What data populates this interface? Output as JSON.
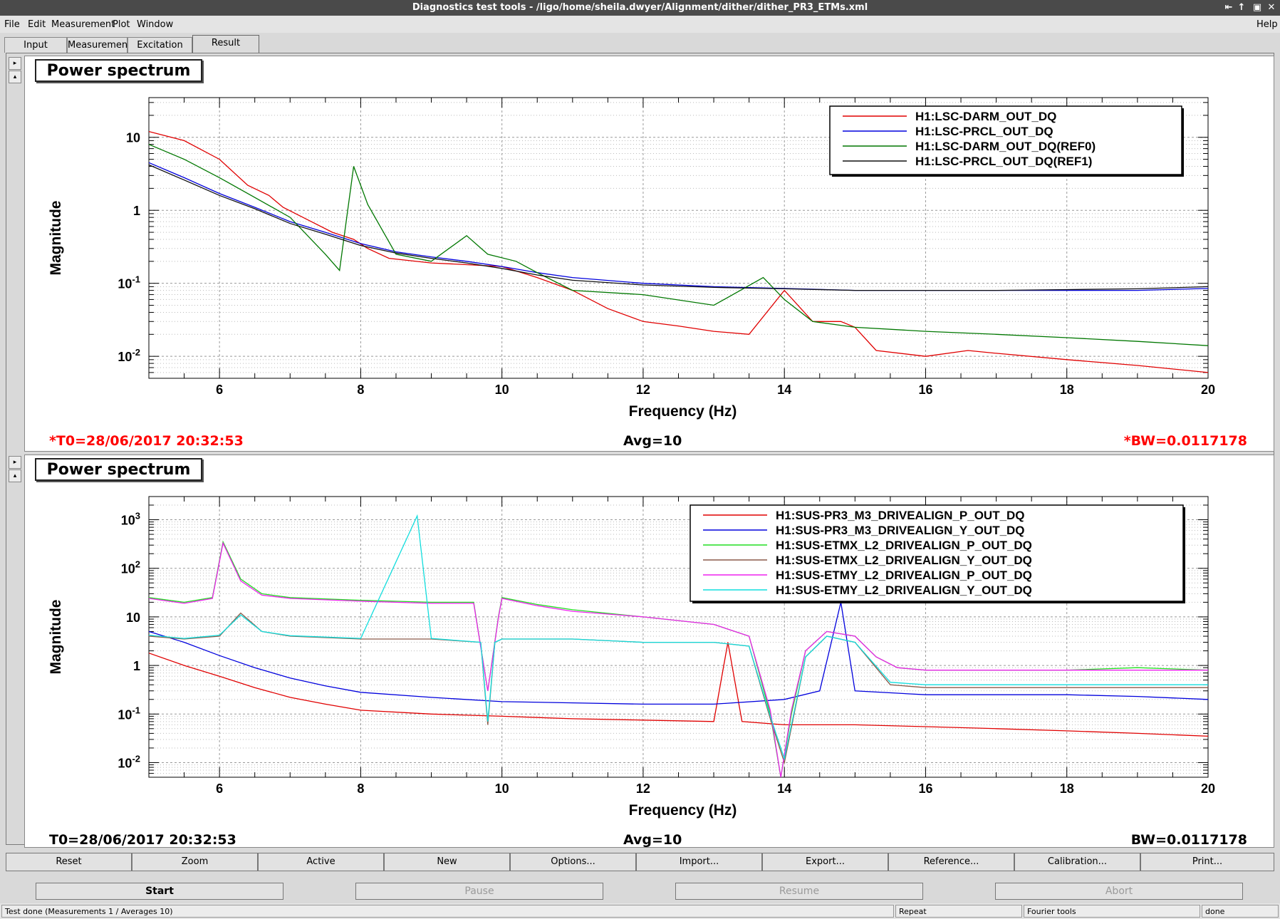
{
  "window": {
    "title": "Diagnostics test tools - /ligo/home/sheila.dwyer/Alignment/dither/dither_PR3_ETMs.xml",
    "controls": [
      "⇤",
      "↑",
      "▣",
      "✕"
    ]
  },
  "menu": {
    "items": [
      "File",
      "Edit",
      "Measurement",
      "Plot",
      "Window"
    ],
    "help": "Help"
  },
  "tabs": [
    "Input",
    "Measurement",
    "Excitation",
    "Result"
  ],
  "active_tab": "Result",
  "panels": [
    {
      "title": "Power spectrum",
      "footer": {
        "t0": "*T0=28/06/2017 20:32:53",
        "avg": "Avg=10",
        "bw": "*BW=0.0117178",
        "color": "#ff0000"
      }
    },
    {
      "title": "Power spectrum",
      "footer": {
        "t0": "T0=28/06/2017 20:32:53",
        "avg": "Avg=10",
        "bw": "BW=0.0117178",
        "color": "#000000"
      }
    }
  ],
  "chart_data": [
    {
      "type": "line",
      "title": "Power spectrum",
      "xlabel": "Frequency (Hz)",
      "ylabel": "Magnitude",
      "xlim": [
        5,
        20
      ],
      "ylim": [
        0.005,
        35
      ],
      "yscale": "log",
      "grid": true,
      "legend_position": "top-right",
      "x_ticks": [
        "6",
        "8",
        "10",
        "12",
        "14",
        "16",
        "18",
        "20"
      ],
      "y_ticks": [
        "10",
        "1",
        "10-1",
        "10-2"
      ],
      "series": [
        {
          "name": "H1:LSC-DARM_OUT_DQ",
          "color": "#e00000",
          "x": [
            5,
            5.5,
            6,
            6.4,
            6.7,
            6.9,
            7.3,
            7.6,
            7.9,
            8.1,
            8.4,
            9,
            9.5,
            10,
            10.5,
            11,
            11.5,
            12,
            12.5,
            13,
            13.5,
            14,
            14.4,
            14.8,
            15,
            15.3,
            16,
            16.6,
            17,
            18,
            19,
            20
          ],
          "y": [
            12,
            9,
            5,
            2.2,
            1.6,
            1.1,
            0.7,
            0.5,
            0.4,
            0.3,
            0.22,
            0.19,
            0.18,
            0.17,
            0.12,
            0.08,
            0.045,
            0.03,
            0.026,
            0.022,
            0.02,
            0.08,
            0.03,
            0.03,
            0.025,
            0.012,
            0.01,
            0.012,
            0.011,
            0.009,
            0.0075,
            0.006
          ]
        },
        {
          "name": "H1:LSC-PRCL_OUT_DQ",
          "color": "#0000dd",
          "x": [
            5,
            5.5,
            6,
            6.5,
            7,
            7.5,
            8,
            8.5,
            9,
            9.5,
            10,
            10.5,
            11,
            12,
            13,
            14,
            15,
            16,
            17,
            18,
            19,
            20
          ],
          "y": [
            4.5,
            2.8,
            1.7,
            1.1,
            0.7,
            0.5,
            0.35,
            0.27,
            0.23,
            0.2,
            0.17,
            0.14,
            0.12,
            0.1,
            0.09,
            0.085,
            0.08,
            0.08,
            0.08,
            0.08,
            0.08,
            0.085
          ]
        },
        {
          "name": "H1:LSC-DARM_OUT_DQ(REF0)",
          "color": "#007700",
          "x": [
            5,
            5.5,
            6,
            6.5,
            7,
            7.5,
            7.7,
            7.9,
            8.1,
            8.5,
            9,
            9.5,
            9.8,
            10.2,
            10.5,
            11,
            12,
            13,
            13.7,
            14,
            14.4,
            15,
            16,
            17,
            18,
            19,
            20
          ],
          "y": [
            8,
            5,
            2.8,
            1.5,
            0.8,
            0.25,
            0.15,
            4,
            1.2,
            0.25,
            0.2,
            0.45,
            0.25,
            0.2,
            0.14,
            0.08,
            0.07,
            0.05,
            0.12,
            0.06,
            0.03,
            0.025,
            0.022,
            0.02,
            0.018,
            0.016,
            0.014
          ]
        },
        {
          "name": "H1:LSC-PRCL_OUT_DQ(REF1)",
          "color": "#111111",
          "x": [
            5,
            5.5,
            6,
            6.5,
            7,
            7.5,
            8,
            8.5,
            9,
            9.5,
            10,
            10.5,
            11,
            12,
            13,
            14,
            15,
            16,
            17,
            18,
            19,
            20
          ],
          "y": [
            4.2,
            2.6,
            1.6,
            1.05,
            0.66,
            0.47,
            0.33,
            0.26,
            0.22,
            0.19,
            0.16,
            0.13,
            0.11,
            0.095,
            0.088,
            0.084,
            0.08,
            0.08,
            0.08,
            0.082,
            0.084,
            0.09
          ]
        }
      ]
    },
    {
      "type": "line",
      "title": "Power spectrum",
      "xlabel": "Frequency (Hz)",
      "ylabel": "Magnitude",
      "xlim": [
        5,
        20
      ],
      "ylim": [
        0.005,
        3000
      ],
      "yscale": "log",
      "grid": true,
      "legend_position": "top-right",
      "x_ticks": [
        "6",
        "8",
        "10",
        "12",
        "14",
        "16",
        "18",
        "20"
      ],
      "y_ticks": [
        "10^3",
        "10^2",
        "10",
        "1",
        "10^-1",
        "10^-2"
      ],
      "series": [
        {
          "name": "H1:SUS-PR3_M3_DRIVEALIGN_P_OUT_DQ",
          "color": "#e00000",
          "x": [
            5,
            5.5,
            6,
            6.5,
            7,
            7.5,
            8,
            9,
            10,
            11,
            12,
            13,
            13.2,
            13.4,
            14,
            15,
            16,
            17,
            18,
            19,
            20
          ],
          "y": [
            1.8,
            1,
            0.6,
            0.35,
            0.22,
            0.16,
            0.12,
            0.1,
            0.09,
            0.08,
            0.075,
            0.07,
            3,
            0.07,
            0.06,
            0.06,
            0.055,
            0.05,
            0.045,
            0.04,
            0.035
          ]
        },
        {
          "name": "H1:SUS-PR3_M3_DRIVEALIGN_Y_OUT_DQ",
          "color": "#0000dd",
          "x": [
            5,
            5.5,
            6,
            6.5,
            7,
            7.5,
            8,
            9,
            10,
            11,
            12,
            13,
            14,
            14.5,
            14.8,
            15,
            16,
            17,
            18,
            19,
            20
          ],
          "y": [
            5,
            3,
            1.6,
            0.9,
            0.55,
            0.38,
            0.28,
            0.22,
            0.18,
            0.17,
            0.16,
            0.16,
            0.2,
            0.3,
            20,
            0.3,
            0.25,
            0.25,
            0.25,
            0.23,
            0.2
          ]
        },
        {
          "name": "H1:SUS-ETMX_L2_DRIVEALIGN_P_OUT_DQ",
          "color": "#22dd22",
          "x": [
            5,
            5.5,
            5.9,
            6.05,
            6.3,
            6.6,
            7,
            8,
            9,
            9.6,
            9.8,
            9.95,
            10,
            10.5,
            11,
            12,
            13,
            13.5,
            13.8,
            13.95,
            14.1,
            14.3,
            14.6,
            15,
            15.3,
            15.6,
            16,
            17,
            18,
            19,
            20
          ],
          "y": [
            25,
            20,
            25,
            350,
            60,
            30,
            25,
            22,
            20,
            20,
            0.3,
            10,
            25,
            18,
            14,
            10,
            7,
            4,
            0.1,
            0.003,
            0.1,
            2,
            5,
            4,
            1.5,
            0.9,
            0.8,
            0.8,
            0.8,
            0.9,
            0.8
          ]
        },
        {
          "name": "H1:SUS-ETMX_L2_DRIVEALIGN_Y_OUT_DQ",
          "color": "#8b5a4a",
          "x": [
            5,
            5.5,
            6,
            6.3,
            6.6,
            7,
            8,
            9,
            9.7,
            9.8,
            9.9,
            10,
            11,
            12,
            13,
            13.5,
            13.8,
            14,
            14.3,
            14.6,
            15,
            15.5,
            16,
            17,
            18,
            19,
            20
          ],
          "y": [
            4,
            3.5,
            4,
            12,
            5,
            4,
            3.5,
            3.5,
            3,
            0.06,
            3,
            3.5,
            3.5,
            3,
            3,
            2.5,
            0.08,
            0.01,
            1.5,
            4,
            3,
            0.4,
            0.35,
            0.35,
            0.35,
            0.35,
            0.35
          ]
        },
        {
          "name": "H1:SUS-ETMY_L2_DRIVEALIGN_P_OUT_DQ",
          "color": "#ee22ee",
          "x": [
            5,
            5.5,
            5.9,
            6.05,
            6.3,
            6.6,
            7,
            8,
            9,
            9.6,
            9.8,
            9.95,
            10,
            10.5,
            11,
            12,
            13,
            13.5,
            13.8,
            13.95,
            14.1,
            14.3,
            14.6,
            15,
            15.3,
            15.6,
            16,
            17,
            18,
            19,
            20
          ],
          "y": [
            24,
            19,
            24,
            330,
            55,
            28,
            24,
            21,
            19,
            19,
            0.3,
            9.5,
            24,
            17,
            13,
            10,
            7,
            4,
            0.12,
            0.004,
            0.12,
            2,
            5,
            4,
            1.5,
            0.9,
            0.8,
            0.8,
            0.8,
            0.8,
            0.8
          ]
        },
        {
          "name": "H1:SUS-ETMY_L2_DRIVEALIGN_Y_OUT_DQ",
          "color": "#11dddd",
          "x": [
            5,
            5.5,
            6,
            6.3,
            6.6,
            7,
            8,
            8.8,
            9,
            9.7,
            9.8,
            9.9,
            10,
            11,
            12,
            13,
            13.5,
            13.8,
            14,
            14.3,
            14.6,
            15,
            15.5,
            16,
            17,
            18,
            19,
            20
          ],
          "y": [
            4.2,
            3.6,
            4.2,
            11,
            5,
            4.1,
            3.6,
            1200,
            3.6,
            3,
            0.07,
            3,
            3.5,
            3.5,
            3,
            3,
            2.5,
            0.09,
            0.012,
            1.5,
            4,
            3,
            0.45,
            0.4,
            0.4,
            0.4,
            0.4,
            0.4
          ]
        }
      ]
    }
  ],
  "buttons": [
    "Reset",
    "Zoom",
    "Active",
    "New",
    "Options...",
    "Import...",
    "Export...",
    "Reference...",
    "Calibration...",
    "Print..."
  ],
  "controls": [
    "Start",
    "Pause",
    "Resume",
    "Abort"
  ],
  "status": {
    "message": "Test done (Measurements 1 / Averages 10)",
    "repeat": "Repeat",
    "tool": "Fourier tools",
    "state": "done"
  }
}
